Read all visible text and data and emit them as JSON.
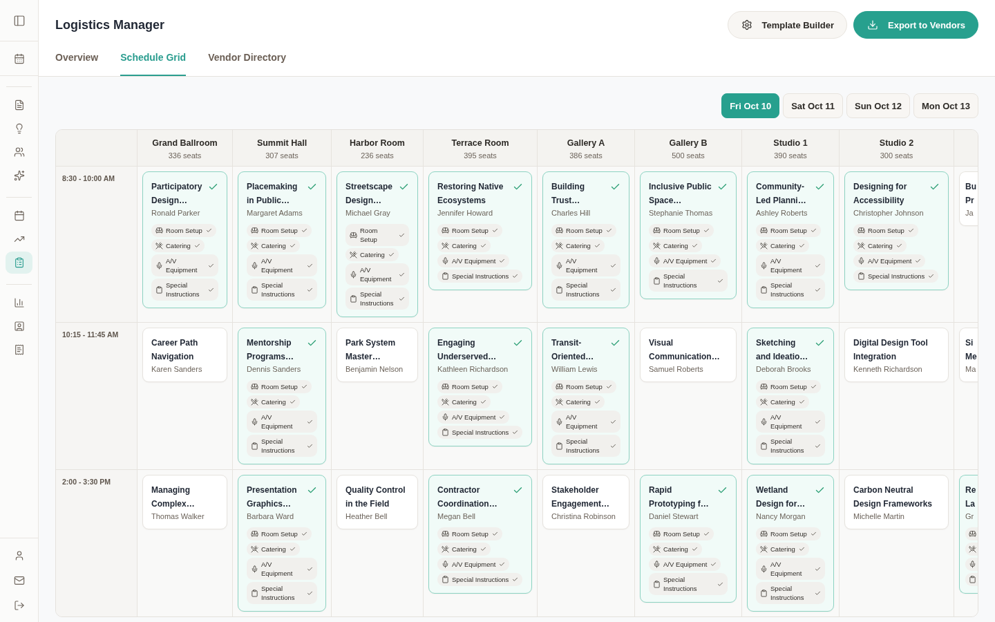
{
  "sidebar": {
    "pinned": [
      {
        "selected": false
      }
    ],
    "groups": [
      {
        "items": [
          {
            "selected": false
          },
          {
            "selected": false
          },
          {
            "selected": false
          },
          {
            "selected": false
          }
        ]
      },
      {
        "items": [
          {
            "selected": false
          },
          {
            "selected": false
          },
          {
            "selected": true
          }
        ]
      },
      {
        "items": [
          {
            "selected": false
          },
          {
            "selected": false
          },
          {
            "selected": false
          }
        ]
      }
    ],
    "footer": [
      {
        "selected": false
      },
      {
        "selected": false
      },
      {
        "selected": false
      }
    ]
  },
  "header": {
    "title": "Logistics Manager",
    "buttons": [
      {
        "label": "Template Builder",
        "kind": "secondary"
      },
      {
        "label": "Export to Vendors",
        "kind": "primary"
      }
    ]
  },
  "tabs": [
    {
      "label": "Overview",
      "selected": false
    },
    {
      "label": "Schedule Grid",
      "selected": true
    },
    {
      "label": "Vendor Directory",
      "selected": false
    }
  ],
  "dates": [
    {
      "label": "Fri Oct 10",
      "selected": true
    },
    {
      "label": "Sat Oct 11",
      "selected": false
    },
    {
      "label": "Sun Oct 12",
      "selected": false
    },
    {
      "label": "Mon Oct 13",
      "selected": false
    }
  ],
  "grid": {
    "rooms": [
      {
        "name": "Grand Ballroom",
        "seats": "336 seats"
      },
      {
        "name": "Summit Hall",
        "seats": "307 seats"
      },
      {
        "name": "Harbor Room",
        "seats": "236 seats"
      },
      {
        "name": "Terrace Room",
        "seats": "395 seats"
      },
      {
        "name": "Gallery A",
        "seats": "386 seats"
      },
      {
        "name": "Gallery B",
        "seats": "500 seats"
      },
      {
        "name": "Studio 1",
        "seats": "390 seats"
      },
      {
        "name": "Studio 2",
        "seats": "300 seats"
      }
    ],
    "slots": [
      {
        "time": "8:30 - 10:00 AM",
        "sessions": [
          {
            "title": "Participatory Design…",
            "speaker": "Ronald Parker",
            "confirmed": true,
            "clipped": false,
            "services": [
              {
                "kind": "room_setup",
                "label": "Room Setup",
                "done": true
              },
              {
                "kind": "catering",
                "label": "Catering",
                "done": true
              },
              {
                "kind": "av",
                "label": "A/V Equipment",
                "done": true
              },
              {
                "kind": "special",
                "label": "Special Instructions",
                "done": true
              }
            ]
          },
          {
            "title": "Placemaking in Public…",
            "speaker": "Margaret Adams",
            "confirmed": true,
            "clipped": false,
            "services": [
              {
                "kind": "room_setup",
                "label": "Room Setup",
                "done": true
              },
              {
                "kind": "catering",
                "label": "Catering",
                "done": true
              },
              {
                "kind": "av",
                "label": "A/V Equipment",
                "done": true
              },
              {
                "kind": "special",
                "label": "Special Instructions",
                "done": true
              }
            ]
          },
          {
            "title": "Streetscape Design…",
            "speaker": "Michael Gray",
            "confirmed": true,
            "clipped": false,
            "services": [
              {
                "kind": "room_setup",
                "label": "Room Setup",
                "done": true
              },
              {
                "kind": "catering",
                "label": "Catering",
                "done": true
              },
              {
                "kind": "av",
                "label": "A/V Equipment",
                "done": true
              },
              {
                "kind": "special",
                "label": "Special Instructions",
                "done": true
              }
            ]
          },
          {
            "title": "Restoring Native Ecosystems",
            "speaker": "Jennifer Howard",
            "confirmed": true,
            "clipped": false,
            "services": [
              {
                "kind": "room_setup",
                "label": "Room Setup",
                "done": true
              },
              {
                "kind": "catering",
                "label": "Catering",
                "done": true
              },
              {
                "kind": "av",
                "label": "A/V Equipment",
                "done": true
              },
              {
                "kind": "special",
                "label": "Special Instructions",
                "done": true
              }
            ]
          },
          {
            "title": "Building Trust…",
            "speaker": "Charles Hill",
            "confirmed": true,
            "clipped": false,
            "services": [
              {
                "kind": "room_setup",
                "label": "Room Setup",
                "done": true
              },
              {
                "kind": "catering",
                "label": "Catering",
                "done": true
              },
              {
                "kind": "av",
                "label": "A/V Equipment",
                "done": true
              },
              {
                "kind": "special",
                "label": "Special Instructions",
                "done": true
              }
            ]
          },
          {
            "title": "Inclusive Public Space…",
            "speaker": "Stephanie Thomas",
            "confirmed": true,
            "clipped": false,
            "services": [
              {
                "kind": "room_setup",
                "label": "Room Setup",
                "done": true
              },
              {
                "kind": "catering",
                "label": "Catering",
                "done": true
              },
              {
                "kind": "av",
                "label": "A/V Equipment",
                "done": true
              },
              {
                "kind": "special",
                "label": "Special Instructions",
                "done": true
              }
            ]
          },
          {
            "title": "Community-Led Planni…",
            "speaker": "Ashley Roberts",
            "confirmed": true,
            "clipped": false,
            "services": [
              {
                "kind": "room_setup",
                "label": "Room Setup",
                "done": true
              },
              {
                "kind": "catering",
                "label": "Catering",
                "done": true
              },
              {
                "kind": "av",
                "label": "A/V Equipment",
                "done": true
              },
              {
                "kind": "special",
                "label": "Special Instructions",
                "done": true
              }
            ]
          },
          {
            "title": "Designing for Accessibility",
            "speaker": "Christopher Johnson",
            "confirmed": true,
            "clipped": false,
            "services": [
              {
                "kind": "room_setup",
                "label": "Room Setup",
                "done": true
              },
              {
                "kind": "catering",
                "label": "Catering",
                "done": true
              },
              {
                "kind": "av",
                "label": "A/V Equipment",
                "done": true
              },
              {
                "kind": "special",
                "label": "Special Instructions",
                "done": true
              }
            ]
          },
          {
            "title": "Bu Pr",
            "speaker": "Ja",
            "confirmed": false,
            "clipped": true
          }
        ]
      },
      {
        "time": "10:15 - 11:45 AM",
        "sessions": [
          {
            "title": "Career Path Navigation",
            "speaker": "Karen Sanders",
            "confirmed": false,
            "clipped": false
          },
          {
            "title": "Mentorship Programs…",
            "speaker": "Dennis Sanders",
            "confirmed": true,
            "clipped": false,
            "services": [
              {
                "kind": "room_setup",
                "label": "Room Setup",
                "done": true
              },
              {
                "kind": "catering",
                "label": "Catering",
                "done": true
              },
              {
                "kind": "av",
                "label": "A/V Equipment",
                "done": true
              },
              {
                "kind": "special",
                "label": "Special Instructions",
                "done": true
              }
            ]
          },
          {
            "title": "Park System Master…",
            "speaker": "Benjamin Nelson",
            "confirmed": false,
            "clipped": false
          },
          {
            "title": "Engaging Underserved…",
            "speaker": "Kathleen Richardson",
            "confirmed": true,
            "clipped": false,
            "services": [
              {
                "kind": "room_setup",
                "label": "Room Setup",
                "done": true
              },
              {
                "kind": "catering",
                "label": "Catering",
                "done": true
              },
              {
                "kind": "av",
                "label": "A/V Equipment",
                "done": true
              },
              {
                "kind": "special",
                "label": "Special Instructions",
                "done": true
              }
            ]
          },
          {
            "title": "Transit-Oriented…",
            "speaker": "William Lewis",
            "confirmed": true,
            "clipped": false,
            "services": [
              {
                "kind": "room_setup",
                "label": "Room Setup",
                "done": true
              },
              {
                "kind": "catering",
                "label": "Catering",
                "done": true
              },
              {
                "kind": "av",
                "label": "A/V Equipment",
                "done": true
              },
              {
                "kind": "special",
                "label": "Special Instructions",
                "done": true
              }
            ]
          },
          {
            "title": "Visual Communication…",
            "speaker": "Samuel Roberts",
            "confirmed": false,
            "clipped": false
          },
          {
            "title": "Sketching and Ideatio…",
            "speaker": "Deborah Brooks",
            "confirmed": true,
            "clipped": false,
            "services": [
              {
                "kind": "room_setup",
                "label": "Room Setup",
                "done": true
              },
              {
                "kind": "catering",
                "label": "Catering",
                "done": true
              },
              {
                "kind": "av",
                "label": "A/V Equipment",
                "done": true
              },
              {
                "kind": "special",
                "label": "Special Instructions",
                "done": true
              }
            ]
          },
          {
            "title": "Digital Design Tool Integration",
            "speaker": "Kenneth Richardson",
            "confirmed": false,
            "clipped": false
          },
          {
            "title": "Si Me",
            "speaker": "Ma",
            "confirmed": false,
            "clipped": true
          }
        ]
      },
      {
        "time": "2:00 - 3:30 PM",
        "sessions": [
          {
            "title": "Managing Complex…",
            "speaker": "Thomas Walker",
            "confirmed": false,
            "clipped": false
          },
          {
            "title": "Presentation Graphics…",
            "speaker": "Barbara Ward",
            "confirmed": true,
            "clipped": false,
            "services": [
              {
                "kind": "room_setup",
                "label": "Room Setup",
                "done": true
              },
              {
                "kind": "catering",
                "label": "Catering",
                "done": true
              },
              {
                "kind": "av",
                "label": "A/V Equipment",
                "done": true
              },
              {
                "kind": "special",
                "label": "Special Instructions",
                "done": true
              }
            ]
          },
          {
            "title": "Quality Control in the Field",
            "speaker": "Heather Bell",
            "confirmed": false,
            "clipped": false
          },
          {
            "title": "Contractor Coordination…",
            "speaker": "Megan Bell",
            "confirmed": true,
            "clipped": false,
            "services": [
              {
                "kind": "room_setup",
                "label": "Room Setup",
                "done": true
              },
              {
                "kind": "catering",
                "label": "Catering",
                "done": true
              },
              {
                "kind": "av",
                "label": "A/V Equipment",
                "done": true
              },
              {
                "kind": "special",
                "label": "Special Instructions",
                "done": true
              }
            ]
          },
          {
            "title": "Stakeholder Engagement…",
            "speaker": "Christina Robinson",
            "confirmed": false,
            "clipped": false
          },
          {
            "title": "Rapid Prototyping f…",
            "speaker": "Daniel Stewart",
            "confirmed": true,
            "clipped": false,
            "services": [
              {
                "kind": "room_setup",
                "label": "Room Setup",
                "done": true
              },
              {
                "kind": "catering",
                "label": "Catering",
                "done": true
              },
              {
                "kind": "av",
                "label": "A/V Equipment",
                "done": true
              },
              {
                "kind": "special",
                "label": "Special Instructions",
                "done": true
              }
            ]
          },
          {
            "title": "Wetland Design for…",
            "speaker": "Nancy Morgan",
            "confirmed": true,
            "clipped": false,
            "services": [
              {
                "kind": "room_setup",
                "label": "Room Setup",
                "done": true
              },
              {
                "kind": "catering",
                "label": "Catering",
                "done": true
              },
              {
                "kind": "av",
                "label": "A/V Equipment",
                "done": true
              },
              {
                "kind": "special",
                "label": "Special Instructions",
                "done": true
              }
            ]
          },
          {
            "title": "Carbon Neutral Design Frameworks",
            "speaker": "Michelle Martin",
            "confirmed": false,
            "clipped": false
          },
          {
            "title": "Re La",
            "speaker": "Gr",
            "confirmed": true,
            "clipped": true,
            "services": [
              {
                "kind": "room_setup"
              },
              {
                "kind": "catering"
              },
              {
                "kind": "av"
              },
              {
                "kind": "special"
              }
            ]
          }
        ]
      }
    ]
  }
}
